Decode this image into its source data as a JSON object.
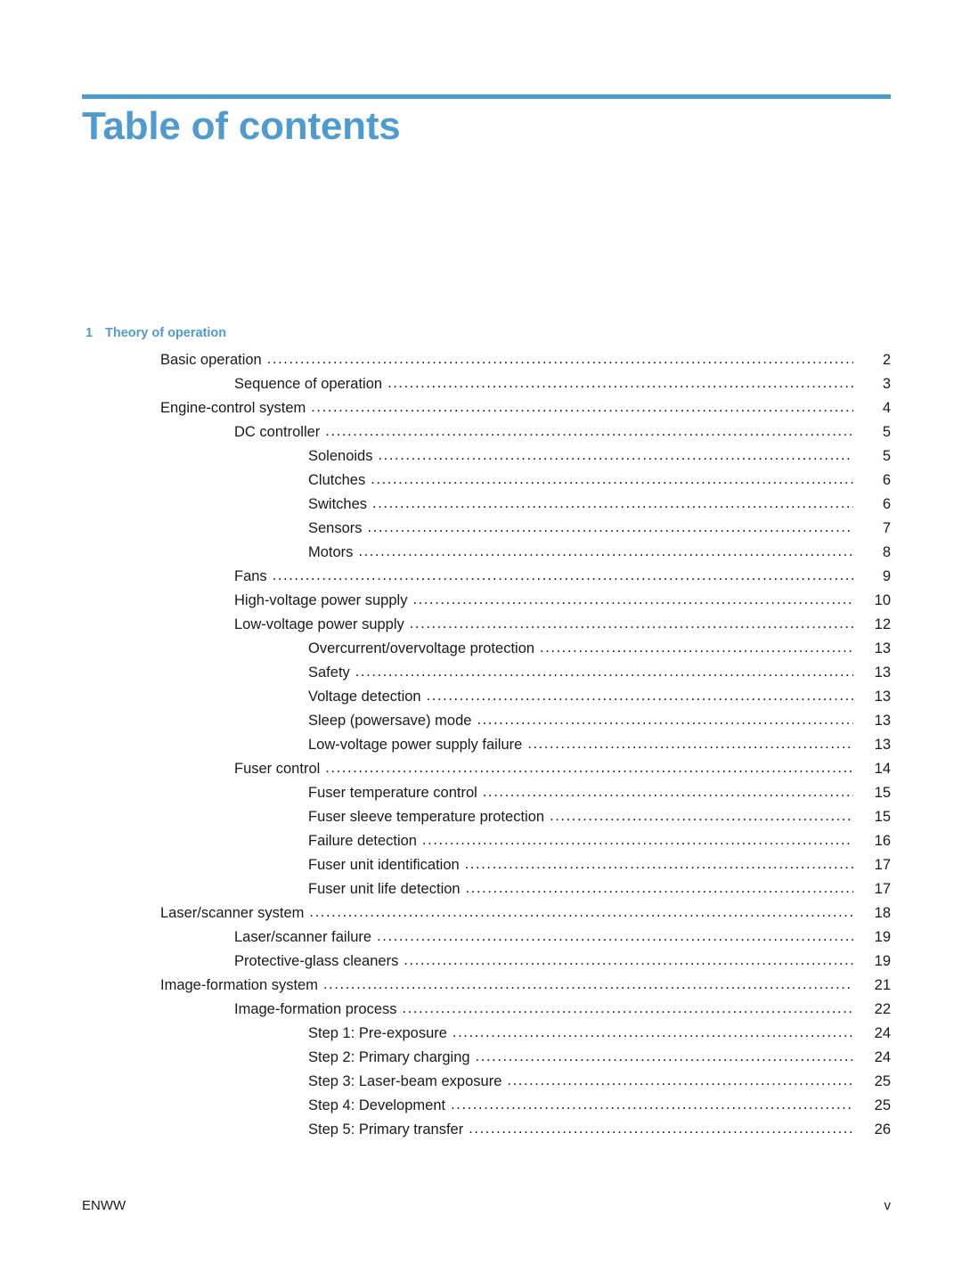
{
  "document": {
    "title": "Table of contents",
    "accent_color": "#4F9BD0"
  },
  "chapter": {
    "number": "1",
    "title": "Theory of operation"
  },
  "toc": {
    "leader_char": "..............................................................................................................................................................................",
    "entries": [
      {
        "label": "Basic operation",
        "page": "2",
        "level": 1
      },
      {
        "label": "Sequence of operation",
        "page": "3",
        "level": 2
      },
      {
        "label": "Engine-control system",
        "page": "4",
        "level": 1
      },
      {
        "label": "DC controller",
        "page": "5",
        "level": 2
      },
      {
        "label": "Solenoids",
        "page": "5",
        "level": 3
      },
      {
        "label": "Clutches",
        "page": "6",
        "level": 3
      },
      {
        "label": "Switches",
        "page": "6",
        "level": 3
      },
      {
        "label": "Sensors",
        "page": "7",
        "level": 3
      },
      {
        "label": "Motors",
        "page": "8",
        "level": 3
      },
      {
        "label": "Fans",
        "page": "9",
        "level": 2
      },
      {
        "label": "High-voltage power supply",
        "page": "10",
        "level": 2
      },
      {
        "label": "Low-voltage power supply",
        "page": "12",
        "level": 2
      },
      {
        "label": "Overcurrent/overvoltage protection",
        "page": "13",
        "level": 3
      },
      {
        "label": "Safety",
        "page": "13",
        "level": 3
      },
      {
        "label": "Voltage detection",
        "page": "13",
        "level": 3
      },
      {
        "label": "Sleep (powersave) mode",
        "page": "13",
        "level": 3
      },
      {
        "label": "Low-voltage power supply failure",
        "page": "13",
        "level": 3
      },
      {
        "label": "Fuser control",
        "page": "14",
        "level": 2
      },
      {
        "label": "Fuser temperature control",
        "page": "15",
        "level": 3
      },
      {
        "label": "Fuser sleeve temperature protection",
        "page": "15",
        "level": 3
      },
      {
        "label": "Failure detection",
        "page": "16",
        "level": 3
      },
      {
        "label": "Fuser unit identification",
        "page": "17",
        "level": 3
      },
      {
        "label": "Fuser unit life detection",
        "page": "17",
        "level": 3
      },
      {
        "label": "Laser/scanner system",
        "page": "18",
        "level": 1
      },
      {
        "label": "Laser/scanner failure",
        "page": "19",
        "level": 2
      },
      {
        "label": "Protective-glass cleaners",
        "page": "19",
        "level": 2
      },
      {
        "label": "Image-formation system",
        "page": "21",
        "level": 1
      },
      {
        "label": "Image-formation process",
        "page": "22",
        "level": 2
      },
      {
        "label": "Step 1: Pre-exposure",
        "page": "24",
        "level": 3
      },
      {
        "label": "Step 2: Primary charging",
        "page": "24",
        "level": 3
      },
      {
        "label": "Step 3: Laser-beam exposure",
        "page": "25",
        "level": 3
      },
      {
        "label": "Step 4: Development",
        "page": "25",
        "level": 3
      },
      {
        "label": "Step 5: Primary transfer",
        "page": "26",
        "level": 3
      }
    ]
  },
  "footer": {
    "left": "ENWW",
    "right": "v"
  }
}
